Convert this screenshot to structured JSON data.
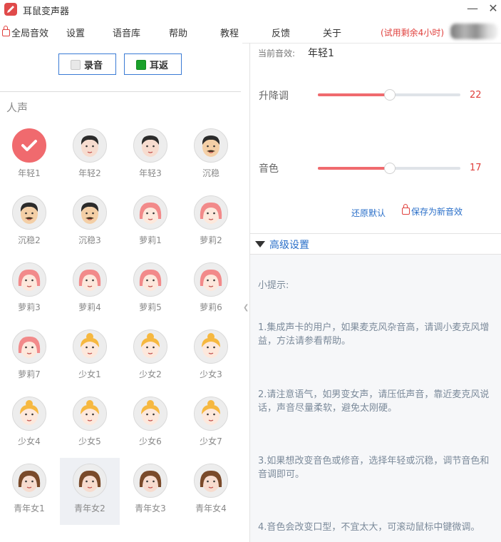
{
  "app": {
    "title": "耳鼠变声器",
    "icon": "pencil-icon",
    "minimize_label": "—",
    "close_label": "✕"
  },
  "menu": {
    "items": [
      "全局音效",
      "设置",
      "语音库",
      "帮助",
      "教程",
      "反馈",
      "关于"
    ],
    "trial_text": "(试用剩余4小时)"
  },
  "controls": {
    "record_label": "录音",
    "monitor_label": "耳返"
  },
  "section": {
    "title": "人声"
  },
  "voices": [
    {
      "label": "年轻1",
      "kind": "selected"
    },
    {
      "label": "年轻2",
      "kind": "boy"
    },
    {
      "label": "年轻3",
      "kind": "boy"
    },
    {
      "label": "沉稳",
      "kind": "man"
    },
    {
      "label": "沉稳2",
      "kind": "man"
    },
    {
      "label": "沉稳3",
      "kind": "man"
    },
    {
      "label": "萝莉1",
      "kind": "loli"
    },
    {
      "label": "萝莉2",
      "kind": "loli"
    },
    {
      "label": "萝莉3",
      "kind": "loli"
    },
    {
      "label": "萝莉4",
      "kind": "loli"
    },
    {
      "label": "萝莉5",
      "kind": "loli"
    },
    {
      "label": "萝莉6",
      "kind": "loli"
    },
    {
      "label": "萝莉7",
      "kind": "loli"
    },
    {
      "label": "少女1",
      "kind": "girl"
    },
    {
      "label": "少女2",
      "kind": "girl"
    },
    {
      "label": "少女3",
      "kind": "girl"
    },
    {
      "label": "少女4",
      "kind": "girl"
    },
    {
      "label": "少女5",
      "kind": "girl"
    },
    {
      "label": "少女6",
      "kind": "girl"
    },
    {
      "label": "少女7",
      "kind": "girl"
    },
    {
      "label": "青年女1",
      "kind": "woman"
    },
    {
      "label": "青年女2",
      "kind": "woman",
      "hover": true
    },
    {
      "label": "青年女3",
      "kind": "woman"
    },
    {
      "label": "青年女4",
      "kind": "woman"
    }
  ],
  "effect": {
    "current_label": "当前音效:",
    "current_value": "年轻1"
  },
  "sliders": {
    "pitch": {
      "label": "升降调",
      "value": "22",
      "fill_fraction": 0.5
    },
    "timbre": {
      "label": "音色",
      "value": "17",
      "fill_fraction": 0.5
    }
  },
  "actions": {
    "reset_label": "还原默认",
    "save_label": "保存为新音效"
  },
  "advanced": {
    "title": "高级设置"
  },
  "tips": {
    "heading": "小提示:",
    "items": [
      "1.集成声卡的用户，如果麦克风杂音高，请调小麦克风增益，方法请参看帮助。",
      "2.请注意语气，如男变女声，请压低声音，靠近麦克风说话，声音尽量柔软，避免太刚硬。",
      "3.如果想改变音色或修音，选择年轻或沉稳，调节音色和音调即可。",
      "4.音色会改变口型，不宜太大，可滚动鼠标中键微调。"
    ]
  },
  "colors": {
    "accent": "#f06a6e",
    "link": "#2a6fc9",
    "warning": "#e0403d"
  }
}
